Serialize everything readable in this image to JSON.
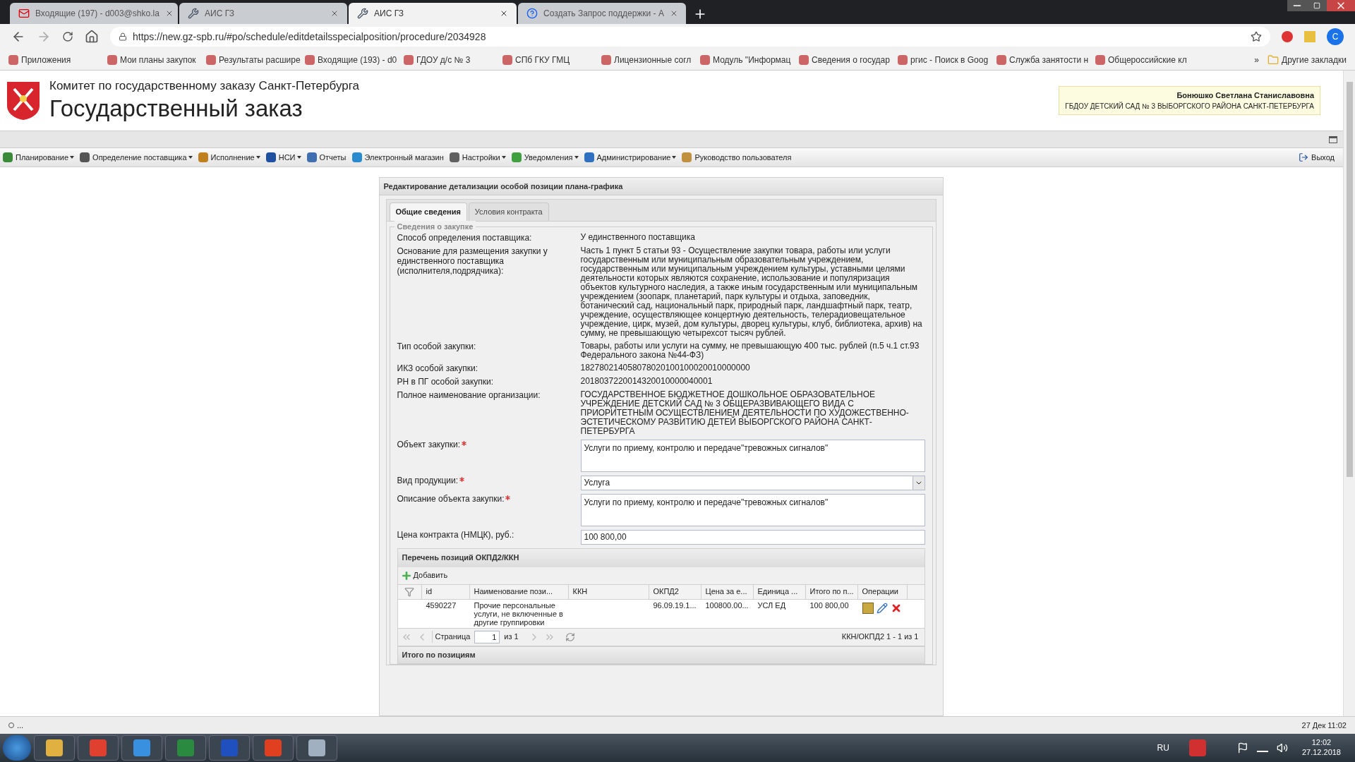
{
  "browser": {
    "tabs": [
      {
        "title": "Входящие (197) - d003@shko.la",
        "selected": false
      },
      {
        "title": "АИС ГЗ",
        "selected": false
      },
      {
        "title": "АИС ГЗ",
        "selected": true
      },
      {
        "title": "Создать Запрос поддержки - А",
        "selected": false
      }
    ],
    "url": "https://new.gz-spb.ru/#po/schedule/editdetailsspecialposition/procedure/2034928",
    "profile": "C",
    "bookmarks": [
      "Приложения",
      "Мои планы закупок",
      "Результаты расшире",
      "Входящие (193) - d0",
      "ГДОУ д/с № 3",
      "СПб ГКУ ГМЦ",
      "Лицензионные согл",
      "Модуль \"Информац",
      "Сведения о государ",
      "ргис - Поиск в Goog",
      "Служба занятости н",
      "Общероссийские кл"
    ],
    "more": "»",
    "other_bookmarks": "Другие закладки"
  },
  "header": {
    "org_title": "Комитет по государственному заказу Санкт-Петербурга",
    "app_title": "Государственный заказ",
    "user_name": "Бонюшко Светлана Станиславовна",
    "user_org": "ГБДОУ ДЕТСКИЙ САД № 3 ВЫБОРГСКОГО РАЙОНА САНКТ-ПЕТЕРБУРГА"
  },
  "menu": {
    "items": [
      {
        "label": "Планирование",
        "dropdown": true
      },
      {
        "label": "Определение поставщика",
        "dropdown": true
      },
      {
        "label": "Исполнение",
        "dropdown": true
      },
      {
        "label": "НСИ",
        "dropdown": true
      },
      {
        "label": "Отчеты",
        "dropdown": false
      },
      {
        "label": "Электронный магазин",
        "dropdown": false
      },
      {
        "label": "Настройки",
        "dropdown": true
      },
      {
        "label": "Уведомления",
        "dropdown": true
      },
      {
        "label": "Администрирование",
        "dropdown": true
      },
      {
        "label": "Руководство пользователя",
        "dropdown": false
      }
    ],
    "exit": "Выход"
  },
  "form": {
    "title": "Редактирование детализации особой позиции плана-графика",
    "tabs": [
      {
        "label": "Общие сведения",
        "selected": true
      },
      {
        "label": "Условия контракта",
        "selected": false
      }
    ],
    "legend": "Сведения о закупке",
    "fields": [
      {
        "kind": "text",
        "label": "Способ определения поставщика:",
        "required": false,
        "value": "У единственного поставщика"
      },
      {
        "kind": "text",
        "label": "Основание для размещения закупки у единственного поставщика (исполнителя,подрядчика):",
        "required": false,
        "value": "Часть 1 пункт 5 статьи 93 - Осуществление закупки товара, работы или услуги государственным или муниципальным образовательным учреждением, государственным или муниципальным учреждением культуры, уставными целями деятельности которых являются сохранение, использование и популяризация объектов культурного наследия, а также иным государственным или муниципальным учреждением (зоопарк, планетарий, парк культуры и отдыха, заповедник, ботанический сад, национальный парк, природный парк, ландшафтный парк, театр, учреждение, осуществляющее концертную деятельность, телерадиовещательное учреждение, цирк, музей, дом культуры, дворец культуры, клуб, библиотека, архив) на сумму, не превышающую четырехсот тысяч рублей."
      },
      {
        "kind": "text",
        "label": "Тип особой закупки:",
        "required": false,
        "value": "Товары, работы или услуги на сумму, не превышающую 400 тыс. рублей (п.5 ч.1 ст.93 Федерального закона №44-ФЗ)"
      },
      {
        "kind": "text",
        "label": "ИКЗ особой закупки:",
        "required": false,
        "value": "182780214058078020100100020010000000"
      },
      {
        "kind": "text",
        "label": "РН в ПГ особой закупки:",
        "required": false,
        "value": "2018037220014320010000040001"
      },
      {
        "kind": "text",
        "label": "Полное наименование организации:",
        "required": false,
        "value": "ГОСУДАРСТВЕННОЕ БЮДЖЕТНОЕ ДОШКОЛЬНОЕ ОБРАЗОВАТЕЛЬНОЕ УЧРЕЖДЕНИЕ ДЕТСКИЙ САД № 3 ОБЩЕРАЗВИВАЮЩЕГО ВИДА С ПРИОРИТЕТНЫМ ОСУЩЕСТВЛЕНИЕМ ДЕЯТЕЛЬНОСТИ ПО ХУДОЖЕСТВЕННО-ЭСТЕТИЧЕСКОМУ РАЗВИТИЮ ДЕТЕЙ ВЫБОРГСКОГО РАЙОНА САНКТ-ПЕТЕРБУРГА"
      },
      {
        "kind": "textarea",
        "label": "Объект закупки:",
        "required": true,
        "value": "Услуги по приему, контролю и передаче\"тревожных сигналов\""
      },
      {
        "kind": "select",
        "label": "Вид продукции:",
        "required": true,
        "value": "Услуга"
      },
      {
        "kind": "textarea",
        "label": "Описание объекта закупки:",
        "required": true,
        "value": "Услуги по приему, контролю и передаче\"тревожных сигналов\""
      },
      {
        "kind": "input",
        "label": "Цена контракта (НМЦК), руб.:",
        "required": false,
        "value": "100 800,00"
      }
    ],
    "grid": {
      "title": "Перечень позиций ОКПД2/ККН",
      "add": "Добавить",
      "columns": [
        "id",
        "Наименование пози...",
        "ККН",
        "ОКПД2",
        "Цена за е...",
        "Единица ...",
        "Итого по п...",
        "Операции"
      ],
      "rows": [
        [
          "4590227",
          "Прочие персональные услуги, не включенные в другие группировки",
          "",
          "96.09.19.1...",
          "100800.00...",
          "УСЛ ЕД",
          "100 800,00"
        ]
      ],
      "page_label": "Страница",
      "page": "1",
      "of": "из 1",
      "summary": "ККН/ОКПД2 1 - 1 из 1"
    },
    "next_section": "Итого по позициям"
  },
  "status_bar": {
    "left": "...",
    "right": "27 Дек 11:02"
  },
  "taskbar": {
    "lang": "RU",
    "time": "12:02",
    "date": "27.12.2018"
  }
}
